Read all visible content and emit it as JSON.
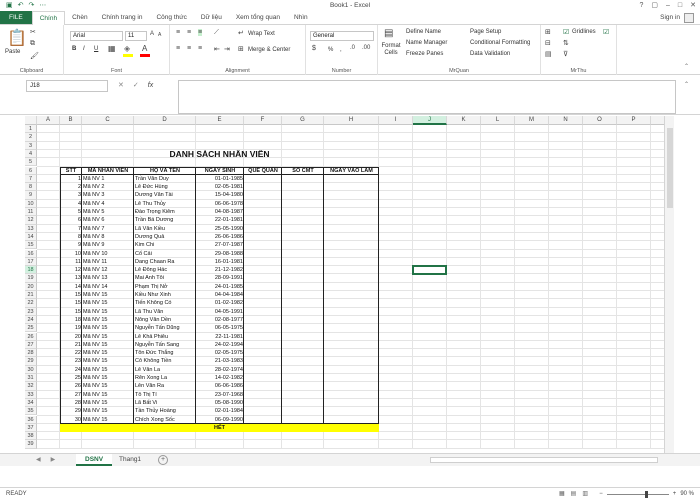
{
  "window": {
    "title": "Book1 - Excel",
    "qat_icons": [
      "save-icon",
      "undo-icon",
      "redo-icon",
      "customize-icon"
    ],
    "controls": [
      "?",
      "▢",
      "–",
      "□",
      "✕"
    ]
  },
  "ribbon_tabs": [
    "FILE",
    "Chính",
    "Chèn",
    "Chính trang in",
    "Công thức",
    "Dữ liệu",
    "Xem tổng quan",
    "Nhìn"
  ],
  "signin": "Sign in",
  "ribbon": {
    "clipboard": {
      "paste": "Paste",
      "label": "Clipboard"
    },
    "font": {
      "name": "Arial",
      "size": "11",
      "label": "Font",
      "bold": "B",
      "italic": "I",
      "underline": "U"
    },
    "alignment": {
      "wrap": "Wrap Text",
      "merge": "Merge & Center",
      "label": "Alignment"
    },
    "number": {
      "format": "General",
      "label": "Number",
      "percent": "%",
      "comma": ","
    },
    "mrquan": {
      "format_cells": "Format Cells",
      "define_name": "Define Name",
      "name_manager": "Name Manager",
      "freeze_panes": "Freeze Panes",
      "page_setup": "Page Setup",
      "conditional": "Conditional Formatting",
      "validation": "Data Validation",
      "label": "MrQuan"
    },
    "mrthu": {
      "gridlines": "Gridlines",
      "label": "MrThu"
    }
  },
  "formula_bar": {
    "name_box": "J18",
    "cancel": "✕",
    "enter": "✓",
    "fx": "fx",
    "value": ""
  },
  "columns": [
    "A",
    "B",
    "C",
    "D",
    "E",
    "F",
    "G",
    "H",
    "I",
    "J",
    "K",
    "L",
    "M",
    "N",
    "O",
    "P",
    "Q"
  ],
  "selected_column": "J",
  "selected_row": 18,
  "sheet": {
    "title": "DANH SÁCH NHÂN VIÊN",
    "headers": [
      "STT",
      "MÃ NHÂN VIÊN",
      "HỌ VÀ TÊN",
      "NGÀY SINH",
      "QUÊ QUÁN",
      "SỐ CMT",
      "NGÀY VÀO LÀM"
    ],
    "rows": [
      [
        "1",
        "Mã NV 1",
        "Trần Văn Duy",
        "01-01-1985"
      ],
      [
        "2",
        "Mã NV 2",
        "Lê Đức Hùng",
        "02-05-1981"
      ],
      [
        "3",
        "Mã NV 3",
        "Dương Văn Tài",
        "15-04-1980"
      ],
      [
        "4",
        "Mã NV 4",
        "Lê Thu Thủy",
        "06-06-1978"
      ],
      [
        "5",
        "Mã NV 5",
        "Đào Trọng Kiêm",
        "04-08-1987"
      ],
      [
        "6",
        "Mã NV 6",
        "Trần Bá Dương",
        "22-01-1981"
      ],
      [
        "7",
        "Mã NV 7",
        "Lã Văn Kiều",
        "25-05-1990"
      ],
      [
        "8",
        "Mã NV 8",
        "Dương Quả",
        "26-06-1986"
      ],
      [
        "9",
        "Mã NV 9",
        "Kim Chi",
        "27-07-1987"
      ],
      [
        "10",
        "Mã NV 10",
        "Cổ Cải",
        "29-08-1988"
      ],
      [
        "11",
        "Mã NV 11",
        "Dang Chaan Ra",
        "16-01-1981"
      ],
      [
        "12",
        "Mã NV 12",
        "Lê Đông Hác",
        "21-12-1982"
      ],
      [
        "13",
        "Mã NV 13",
        "Mai Anh Tôi",
        "28-09-1991"
      ],
      [
        "14",
        "Mã NV 14",
        "Phạm Thị Nở",
        "24-01-1985"
      ],
      [
        "15",
        "Mã NV 15",
        "Kiều Như Xinh",
        "04-04-1984"
      ],
      [
        "15",
        "Mã NV 15",
        "Tiến Không Có",
        "01-02-1982"
      ],
      [
        "15",
        "Mã NV 15",
        "Lã Thu Văn",
        "04-05-1991"
      ],
      [
        "18",
        "Mã NV 15",
        "Nông Văn Dền",
        "02-08-1977"
      ],
      [
        "19",
        "Mã NV 15",
        "Nguyễn Tấn Dũng",
        "06-05-1975"
      ],
      [
        "20",
        "Mã NV 15",
        "Lê Khả Phiêu",
        "22-11-1981"
      ],
      [
        "21",
        "Mã NV 15",
        "Nguyễn Tấn Sang",
        "24-02-1994"
      ],
      [
        "22",
        "Mã NV 15",
        "Tôn Đức Thắng",
        "02-05-1975"
      ],
      [
        "23",
        "Mã NV 15",
        "Cô Không Tiền",
        "21-03-1983"
      ],
      [
        "24",
        "Mã NV 15",
        "Lê Văn La",
        "28-02-1974"
      ],
      [
        "25",
        "Mã NV 15",
        "Rên Xong La",
        "14-02-1982"
      ],
      [
        "26",
        "Mã NV 15",
        "Lên Văn Ra",
        "06-06-1986"
      ],
      [
        "27",
        "Mã NV 15",
        "Tô Thị Tí",
        "23-07-1968"
      ],
      [
        "28",
        "Mã NV 15",
        "Lã Bất Vi",
        "05-08-1990"
      ],
      [
        "29",
        "Mã NV 15",
        "Tần Thủy Hoàng",
        "02-01-1984"
      ],
      [
        "30",
        "Mã NV 15",
        "Chích Xong Sốc",
        "06-09-1990"
      ]
    ],
    "footer": "HẾT"
  },
  "sheet_tabs": [
    "DSNV",
    "Thang1"
  ],
  "active_sheet": "DSNV",
  "status": {
    "ready": "READY",
    "zoom": "90 %"
  },
  "colors": {
    "excel_green": "#217346",
    "footer_yellow": "#ffff00",
    "select_fill": "#d3f0e0"
  }
}
